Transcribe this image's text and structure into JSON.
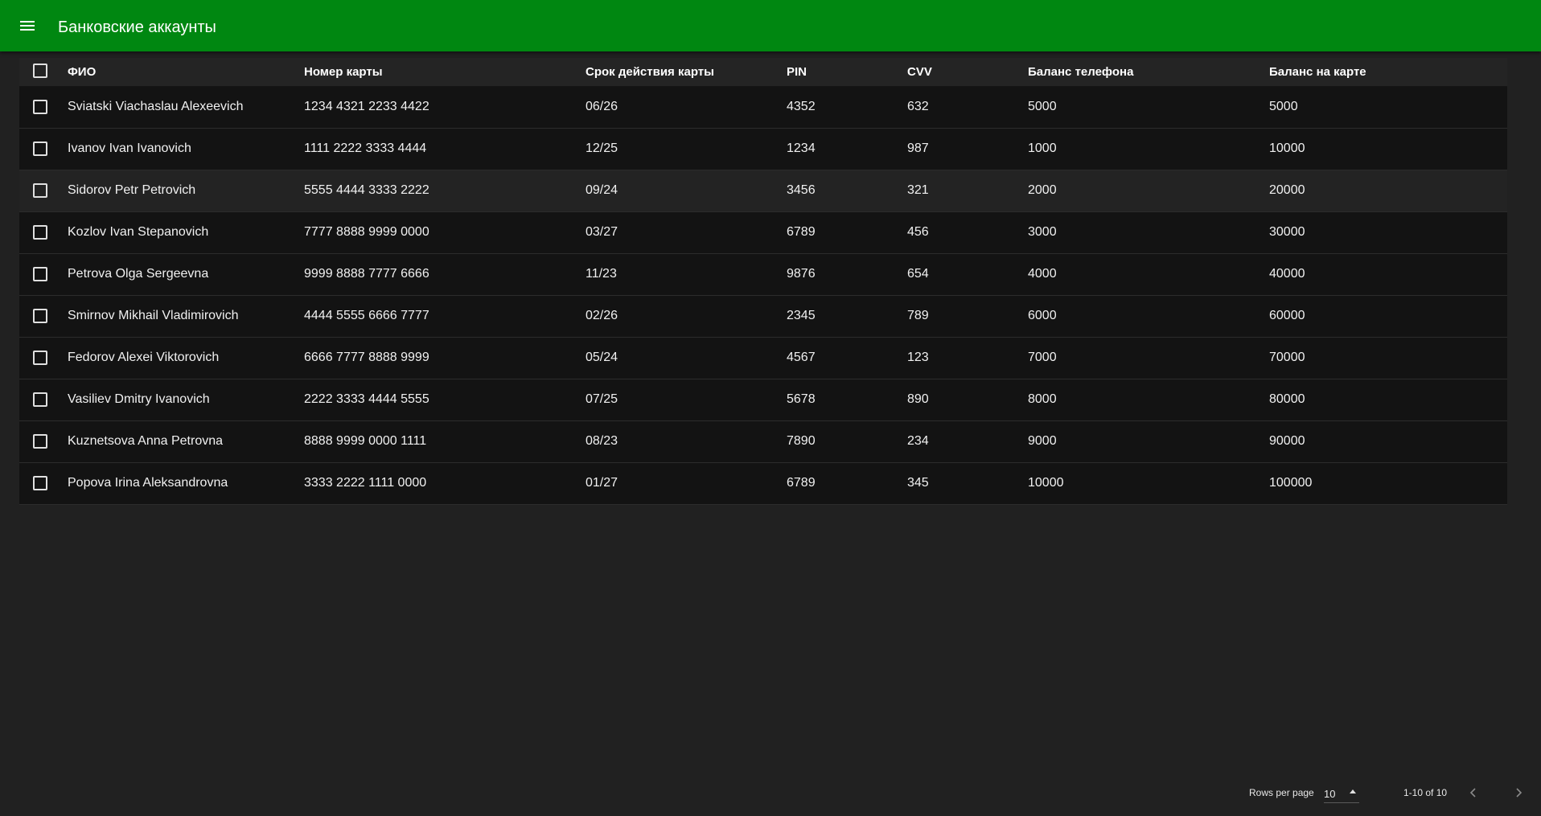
{
  "app": {
    "title": "Банковские аккаунты",
    "menu_icon": "menu-icon",
    "accent_color": "#008711"
  },
  "table": {
    "columns": [
      "ФИО",
      "Номер карты",
      "Срок действия карты",
      "PIN",
      "CVV",
      "Баланс телефона",
      "Баланс на карте"
    ],
    "rows": [
      [
        "Sviatski Viachaslau Alexeevich",
        "1234 4321 2233 4422",
        "06/26",
        "4352",
        "632",
        "5000",
        "5000"
      ],
      [
        "Ivanov Ivan Ivanovich",
        "1111 2222 3333 4444",
        "12/25",
        "1234",
        "987",
        "1000",
        "10000"
      ],
      [
        "Sidorov Petr Petrovich",
        "5555 4444 3333 2222",
        "09/24",
        "3456",
        "321",
        "2000",
        "20000"
      ],
      [
        "Kozlov Ivan Stepanovich",
        "7777 8888 9999 0000",
        "03/27",
        "6789",
        "456",
        "3000",
        "30000"
      ],
      [
        "Petrova Olga Sergeevna",
        "9999 8888 7777 6666",
        "11/23",
        "9876",
        "654",
        "4000",
        "40000"
      ],
      [
        "Smirnov Mikhail Vladimirovich",
        "4444 5555 6666 7777",
        "02/26",
        "2345",
        "789",
        "6000",
        "60000"
      ],
      [
        "Fedorov Alexei Viktorovich",
        "6666 7777 8888 9999",
        "05/24",
        "4567",
        "123",
        "7000",
        "70000"
      ],
      [
        "Vasiliev Dmitry Ivanovich",
        "2222 3333 4444 5555",
        "07/25",
        "5678",
        "890",
        "8000",
        "80000"
      ],
      [
        "Kuznetsova Anna Petrovna",
        "8888 9999 0000 1111",
        "08/23",
        "7890",
        "234",
        "9000",
        "90000"
      ],
      [
        "Popova Irina Aleksandrovna",
        "3333 2222 1111 0000",
        "01/27",
        "6789",
        "345",
        "10000",
        "100000"
      ]
    ]
  },
  "pagination": {
    "rows_per_page_label": "Rows per page",
    "rows_per_page_value": "10",
    "range_label": "1-10 of 10",
    "prev_icon": "chevron-left-icon",
    "next_icon": "chevron-right-icon"
  }
}
